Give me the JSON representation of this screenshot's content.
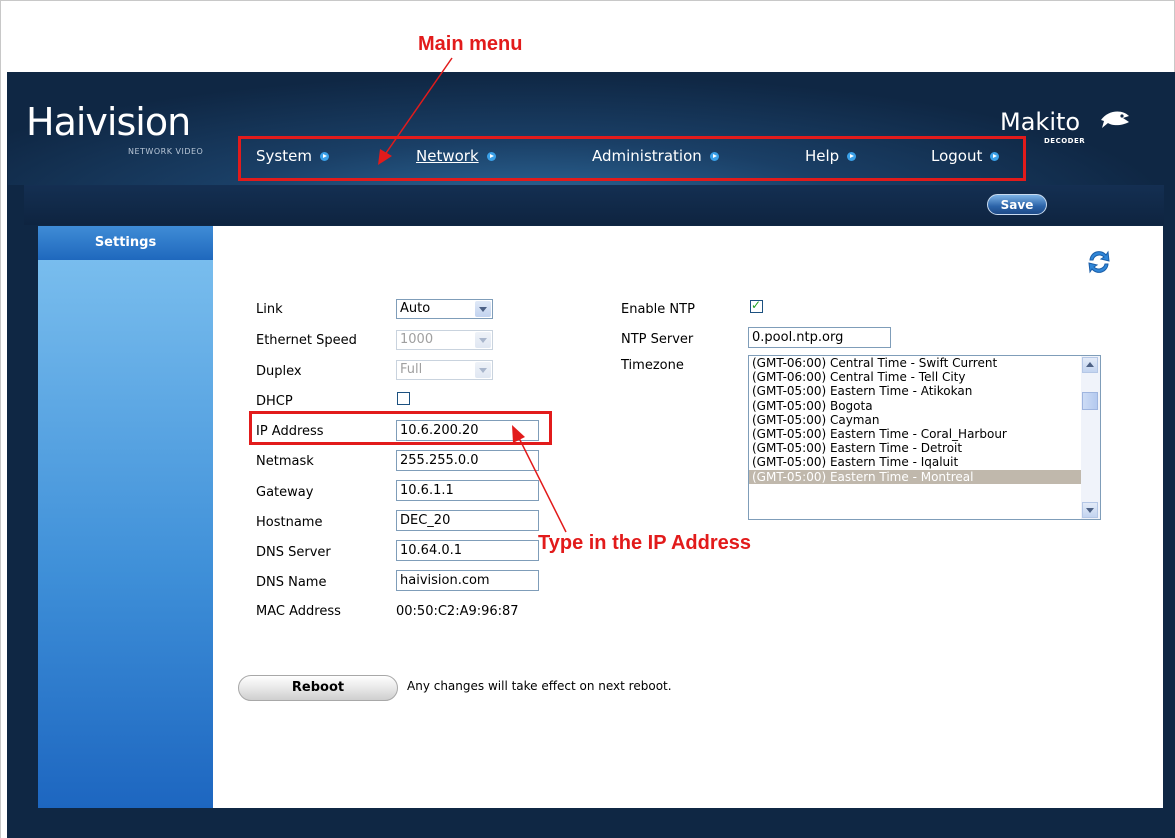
{
  "annotations": {
    "main_menu": "Main menu",
    "ip_hint": "Type in the IP Address"
  },
  "brand": {
    "logo": "Haivision",
    "logo_sub": "NETWORK VIDEO",
    "product": "Makito",
    "product_sub": "DECODER"
  },
  "nav": [
    "System",
    "Network",
    "Administration",
    "Help",
    "Logout"
  ],
  "toolbar": {
    "save_label": "Save"
  },
  "sidebar": {
    "settings_label": "Settings"
  },
  "form": {
    "link": {
      "label": "Link",
      "value": "Auto"
    },
    "ethernet_speed": {
      "label": "Ethernet Speed",
      "value": "1000"
    },
    "duplex": {
      "label": "Duplex",
      "value": "Full"
    },
    "dhcp": {
      "label": "DHCP",
      "checked": false
    },
    "ip_address": {
      "label": "IP Address",
      "value": "10.6.200.20"
    },
    "netmask": {
      "label": "Netmask",
      "value": "255.255.0.0"
    },
    "gateway": {
      "label": "Gateway",
      "value": "10.6.1.1"
    },
    "hostname": {
      "label": "Hostname",
      "value": "DEC_20"
    },
    "dns_server": {
      "label": "DNS Server",
      "value": "10.64.0.1"
    },
    "dns_name": {
      "label": "DNS Name",
      "value": "haivision.com"
    },
    "mac_address": {
      "label": "MAC Address",
      "value": "00:50:C2:A9:96:87"
    },
    "enable_ntp": {
      "label": "Enable NTP",
      "checked": true
    },
    "ntp_server": {
      "label": "NTP Server",
      "value": "0.pool.ntp.org"
    },
    "timezone": {
      "label": "Timezone",
      "options": [
        "(GMT-06:00) Central Time - Swift Current",
        "(GMT-06:00) Central Time - Tell City",
        "(GMT-05:00) Eastern Time - Atikokan",
        "(GMT-05:00) Bogota",
        "(GMT-05:00) Cayman",
        "(GMT-05:00) Eastern Time - Coral_Harbour",
        "(GMT-05:00) Eastern Time - Detroit",
        "(GMT-05:00) Eastern Time - Iqaluit",
        "(GMT-05:00) Eastern Time - Montreal"
      ],
      "selected": "(GMT-05:00) Eastern Time - Montreal"
    }
  },
  "reboot": {
    "button_label": "Reboot",
    "message": "Any changes will take effect on next reboot."
  },
  "colors": {
    "accent": "#3aa0e8",
    "annotation_red": "#e21b1b",
    "header_dark": "#0f2744"
  }
}
